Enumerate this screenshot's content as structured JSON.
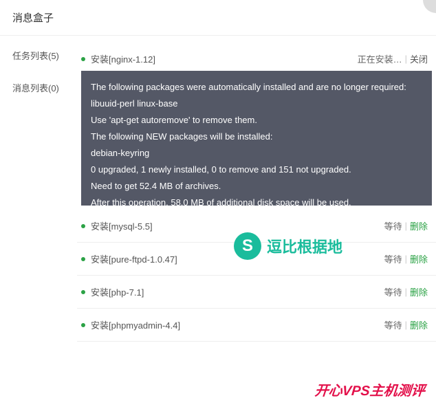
{
  "header": {
    "title": "消息盒子"
  },
  "sidebar": {
    "items": [
      {
        "label": "任务列表(5)",
        "active": true
      },
      {
        "label": "消息列表(0)",
        "active": false
      }
    ]
  },
  "tasks": [
    {
      "name": "安装[nginx-1.12]",
      "status": "正在安装…",
      "action": "关闭",
      "expanded": true
    },
    {
      "name": "安装[mysql-5.5]",
      "status": "等待",
      "action": "删除",
      "expanded": false
    },
    {
      "name": "安装[pure-ftpd-1.0.47]",
      "status": "等待",
      "action": "删除",
      "expanded": false
    },
    {
      "name": "安装[php-7.1]",
      "status": "等待",
      "action": "删除",
      "expanded": false
    },
    {
      "name": "安装[phpmyadmin-4.4]",
      "status": "等待",
      "action": "删除",
      "expanded": false
    }
  ],
  "console": {
    "lines": [
      "The following packages were automatically installed and are no longer required:",
      "libuuid-perl linux-base",
      "Use 'apt-get autoremove' to remove them.",
      "The following NEW packages will be installed:",
      "debian-keyring",
      "0 upgraded, 1 newly installed, 0 to remove and 151 not upgraded.",
      "Need to get 52.4 MB of archives.",
      "After this operation, 58.0 MB of additional disk space will be used."
    ]
  },
  "watermarks": {
    "wm1_logo": "S",
    "wm1_text": "逗比根据地",
    "wm2_text": "开心VPS主机测评"
  },
  "divider": "|"
}
